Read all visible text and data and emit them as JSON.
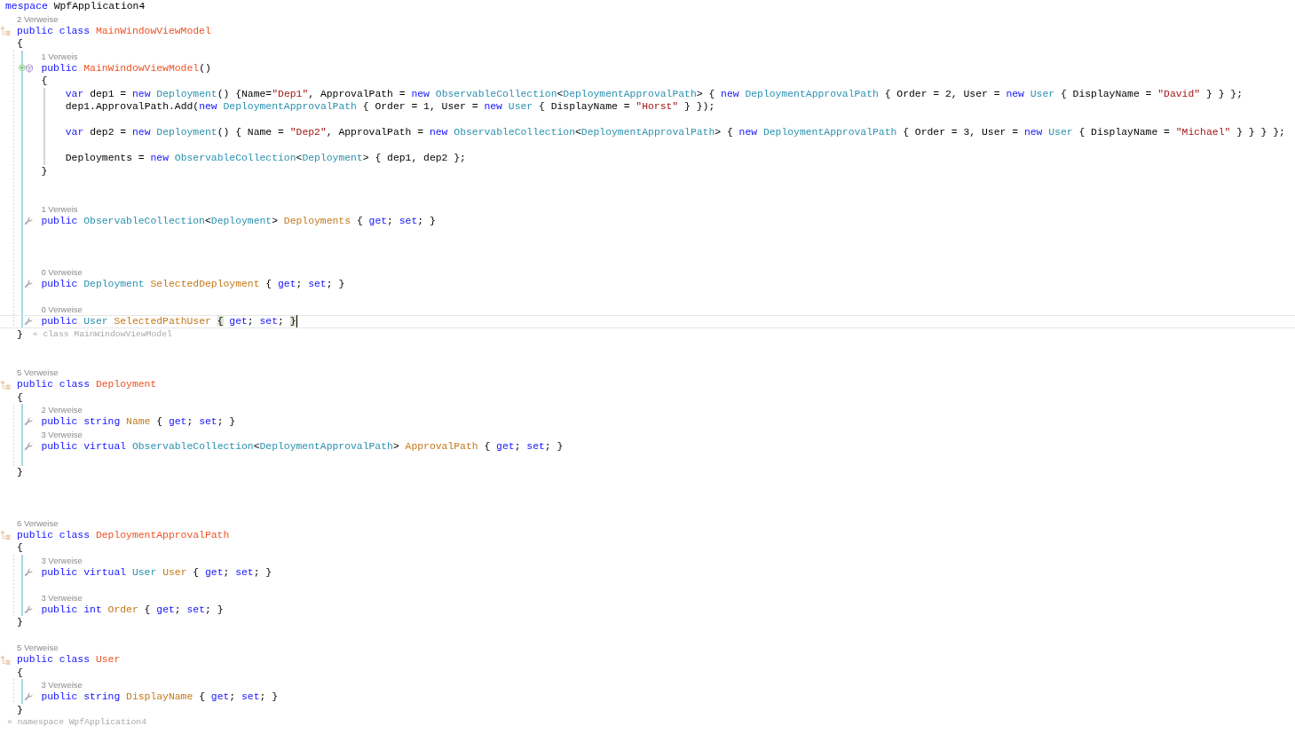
{
  "editor": {
    "lines": [
      {
        "kind": "code",
        "tokens": [
          {
            "text": "mespace",
            "kind": "keyword"
          },
          {
            "text": " WpfApplication4",
            "kind": "plain"
          }
        ]
      },
      {
        "kind": "block",
        "children": [
          {
            "kind": "lens",
            "text": "2 Verweise"
          },
          {
            "kind": "class",
            "tokens": [
              {
                "text": "public class ",
                "kind": "keyword"
              },
              {
                "text": "MainWindowViewModel",
                "kind": "declaration"
              }
            ]
          },
          {
            "kind": "code",
            "tokens": [
              {
                "text": "{",
                "kind": "plain"
              }
            ]
          },
          {
            "kind": "block",
            "children": [
              {
                "kind": "lens",
                "text": "1 Verweis"
              },
              {
                "kind": "method",
                "tokens": [
                  {
                    "text": "public ",
                    "kind": "keyword"
                  },
                  {
                    "text": "MainWindowViewModel",
                    "kind": "declaration"
                  },
                  {
                    "text": "()",
                    "kind": "plain"
                  }
                ]
              },
              {
                "kind": "code",
                "tokens": [
                  {
                    "text": "{",
                    "kind": "plain"
                  }
                ]
              },
              {
                "kind": "block",
                "children": [
                  {
                    "kind": "code",
                    "tokens": [
                      {
                        "text": "var",
                        "kind": "keyword"
                      },
                      {
                        "text": " dep1 = ",
                        "kind": "plain"
                      },
                      {
                        "text": "new ",
                        "kind": "keyword"
                      },
                      {
                        "text": "Deployment",
                        "kind": "type"
                      },
                      {
                        "text": "() {Name=",
                        "kind": "plain"
                      },
                      {
                        "text": "\"Dep1\"",
                        "kind": "string"
                      },
                      {
                        "text": ", ApprovalPath = ",
                        "kind": "plain"
                      },
                      {
                        "text": "new ",
                        "kind": "keyword"
                      },
                      {
                        "text": "ObservableCollection",
                        "kind": "type"
                      },
                      {
                        "text": "<",
                        "kind": "plain"
                      },
                      {
                        "text": "DeploymentApprovalPath",
                        "kind": "type"
                      },
                      {
                        "text": "> { ",
                        "kind": "plain"
                      },
                      {
                        "text": "new ",
                        "kind": "keyword"
                      },
                      {
                        "text": "DeploymentApprovalPath",
                        "kind": "type"
                      },
                      {
                        "text": " { Order = 2, User = ",
                        "kind": "plain"
                      },
                      {
                        "text": "new ",
                        "kind": "keyword"
                      },
                      {
                        "text": "User",
                        "kind": "type"
                      },
                      {
                        "text": " { DisplayName = ",
                        "kind": "plain"
                      },
                      {
                        "text": "\"David\"",
                        "kind": "string"
                      },
                      {
                        "text": " } } };",
                        "kind": "plain"
                      }
                    ]
                  },
                  {
                    "kind": "code",
                    "tokens": [
                      {
                        "text": "dep1.ApprovalPath.Add(",
                        "kind": "plain"
                      },
                      {
                        "text": "new ",
                        "kind": "keyword"
                      },
                      {
                        "text": "DeploymentApprovalPath",
                        "kind": "type"
                      },
                      {
                        "text": " { Order = 1, User = ",
                        "kind": "plain"
                      },
                      {
                        "text": "new ",
                        "kind": "keyword"
                      },
                      {
                        "text": "User",
                        "kind": "type"
                      },
                      {
                        "text": " { DisplayName = ",
                        "kind": "plain"
                      },
                      {
                        "text": "\"Horst\"",
                        "kind": "string"
                      },
                      {
                        "text": " } });",
                        "kind": "plain"
                      }
                    ]
                  },
                  {
                    "kind": "blank"
                  },
                  {
                    "kind": "code",
                    "tokens": [
                      {
                        "text": "var",
                        "kind": "keyword"
                      },
                      {
                        "text": " dep2 = ",
                        "kind": "plain"
                      },
                      {
                        "text": "new ",
                        "kind": "keyword"
                      },
                      {
                        "text": "Deployment",
                        "kind": "type"
                      },
                      {
                        "text": "() { Name = ",
                        "kind": "plain"
                      },
                      {
                        "text": "\"Dep2\"",
                        "kind": "string"
                      },
                      {
                        "text": ", ApprovalPath = ",
                        "kind": "plain"
                      },
                      {
                        "text": "new ",
                        "kind": "keyword"
                      },
                      {
                        "text": "ObservableCollection",
                        "kind": "type"
                      },
                      {
                        "text": "<",
                        "kind": "plain"
                      },
                      {
                        "text": "DeploymentApprovalPath",
                        "kind": "type"
                      },
                      {
                        "text": "> { ",
                        "kind": "plain"
                      },
                      {
                        "text": "new ",
                        "kind": "keyword"
                      },
                      {
                        "text": "DeploymentApprovalPath",
                        "kind": "type"
                      },
                      {
                        "text": " { Order = 3, User = ",
                        "kind": "plain"
                      },
                      {
                        "text": "new ",
                        "kind": "keyword"
                      },
                      {
                        "text": "User",
                        "kind": "type"
                      },
                      {
                        "text": " { DisplayName = ",
                        "kind": "plain"
                      },
                      {
                        "text": "\"Michael\"",
                        "kind": "string"
                      },
                      {
                        "text": " } } } };",
                        "kind": "plain"
                      }
                    ]
                  },
                  {
                    "kind": "blank"
                  },
                  {
                    "kind": "code",
                    "tokens": [
                      {
                        "text": "Deployments = ",
                        "kind": "plain"
                      },
                      {
                        "text": "new ",
                        "kind": "keyword"
                      },
                      {
                        "text": "ObservableCollection",
                        "kind": "type"
                      },
                      {
                        "text": "<",
                        "kind": "plain"
                      },
                      {
                        "text": "Deployment",
                        "kind": "type"
                      },
                      {
                        "text": "> { dep1, dep2 };",
                        "kind": "plain"
                      }
                    ]
                  }
                ]
              },
              {
                "kind": "code",
                "tokens": [
                  {
                    "text": "}",
                    "kind": "plain"
                  }
                ]
              },
              {
                "kind": "blank"
              },
              {
                "kind": "blank"
              },
              {
                "kind": "lens",
                "text": "1 Verweis"
              },
              {
                "kind": "property",
                "tokens": [
                  {
                    "text": "public ",
                    "kind": "keyword"
                  },
                  {
                    "text": "ObservableCollection",
                    "kind": "type"
                  },
                  {
                    "text": "<",
                    "kind": "plain"
                  },
                  {
                    "text": "Deployment",
                    "kind": "type"
                  },
                  {
                    "text": "> ",
                    "kind": "plain"
                  },
                  {
                    "text": "Deployments",
                    "kind": "property"
                  },
                  {
                    "text": " { ",
                    "kind": "plain"
                  },
                  {
                    "text": "get",
                    "kind": "keyword"
                  },
                  {
                    "text": "; ",
                    "kind": "plain"
                  },
                  {
                    "text": "set",
                    "kind": "keyword"
                  },
                  {
                    "text": "; }",
                    "kind": "plain"
                  }
                ]
              },
              {
                "kind": "blank"
              },
              {
                "kind": "blank"
              },
              {
                "kind": "blank"
              },
              {
                "kind": "lens",
                "text": "0 Verweise"
              },
              {
                "kind": "property",
                "tokens": [
                  {
                    "text": "public ",
                    "kind": "keyword"
                  },
                  {
                    "text": "Deployment ",
                    "kind": "type"
                  },
                  {
                    "text": "SelectedDeployment",
                    "kind": "property"
                  },
                  {
                    "text": " { ",
                    "kind": "plain"
                  },
                  {
                    "text": "get",
                    "kind": "keyword"
                  },
                  {
                    "text": "; ",
                    "kind": "plain"
                  },
                  {
                    "text": "set",
                    "kind": "keyword"
                  },
                  {
                    "text": "; }",
                    "kind": "plain"
                  }
                ]
              },
              {
                "kind": "blank"
              },
              {
                "kind": "lens",
                "text": "0 Verweise"
              },
              {
                "kind": "property",
                "current": true,
                "tokens": [
                  {
                    "text": "public ",
                    "kind": "keyword"
                  },
                  {
                    "text": "User ",
                    "kind": "type"
                  },
                  {
                    "text": "SelectedPathUser ",
                    "kind": "property"
                  },
                  {
                    "text": "{",
                    "kind": "plain",
                    "matched": true
                  },
                  {
                    "text": " get",
                    "kind": "keyword"
                  },
                  {
                    "text": "; ",
                    "kind": "plain"
                  },
                  {
                    "text": "set",
                    "kind": "keyword"
                  },
                  {
                    "text": "; ",
                    "kind": "plain"
                  },
                  {
                    "text": "}",
                    "kind": "plain",
                    "matched": true
                  }
                ]
              }
            ]
          },
          {
            "kind": "code",
            "tokens": [
              {
                "text": "}",
                "kind": "plain"
              }
            ],
            "hint": "« class MainWindowViewModel"
          },
          {
            "kind": "blank"
          },
          {
            "kind": "blank"
          },
          {
            "kind": "lens",
            "text": "5 Verweise"
          },
          {
            "kind": "class",
            "tokens": [
              {
                "text": "public class ",
                "kind": "keyword"
              },
              {
                "text": "Deployment",
                "kind": "declaration"
              }
            ]
          },
          {
            "kind": "code",
            "tokens": [
              {
                "text": "{",
                "kind": "plain"
              }
            ]
          },
          {
            "kind": "block",
            "children": [
              {
                "kind": "lens",
                "text": "2 Verweise"
              },
              {
                "kind": "property",
                "tokens": [
                  {
                    "text": "public string ",
                    "kind": "keyword"
                  },
                  {
                    "text": "Name",
                    "kind": "property"
                  },
                  {
                    "text": " { ",
                    "kind": "plain"
                  },
                  {
                    "text": "get",
                    "kind": "keyword"
                  },
                  {
                    "text": "; ",
                    "kind": "plain"
                  },
                  {
                    "text": "set",
                    "kind": "keyword"
                  },
                  {
                    "text": "; }",
                    "kind": "plain"
                  }
                ]
              },
              {
                "kind": "lens",
                "text": "3 Verweise"
              },
              {
                "kind": "property",
                "tokens": [
                  {
                    "text": "public virtual ",
                    "kind": "keyword"
                  },
                  {
                    "text": "ObservableCollection",
                    "kind": "type"
                  },
                  {
                    "text": "<",
                    "kind": "plain"
                  },
                  {
                    "text": "DeploymentApprovalPath",
                    "kind": "type"
                  },
                  {
                    "text": "> ",
                    "kind": "plain"
                  },
                  {
                    "text": "ApprovalPath",
                    "kind": "property"
                  },
                  {
                    "text": " { ",
                    "kind": "plain"
                  },
                  {
                    "text": "get",
                    "kind": "keyword"
                  },
                  {
                    "text": "; ",
                    "kind": "plain"
                  },
                  {
                    "text": "set",
                    "kind": "keyword"
                  },
                  {
                    "text": "; }",
                    "kind": "plain"
                  }
                ]
              },
              {
                "kind": "blank"
              }
            ]
          },
          {
            "kind": "code",
            "tokens": [
              {
                "text": "}",
                "kind": "plain"
              }
            ]
          },
          {
            "kind": "blank"
          },
          {
            "kind": "blank"
          },
          {
            "kind": "blank"
          },
          {
            "kind": "lens",
            "text": "6 Verweise"
          },
          {
            "kind": "class",
            "tokens": [
              {
                "text": "public class ",
                "kind": "keyword"
              },
              {
                "text": "DeploymentApprovalPath",
                "kind": "declaration"
              }
            ]
          },
          {
            "kind": "code",
            "tokens": [
              {
                "text": "{",
                "kind": "plain"
              }
            ]
          },
          {
            "kind": "block",
            "children": [
              {
                "kind": "lens",
                "text": "3 Verweise"
              },
              {
                "kind": "property",
                "tokens": [
                  {
                    "text": "public virtual ",
                    "kind": "keyword"
                  },
                  {
                    "text": "User ",
                    "kind": "type"
                  },
                  {
                    "text": "User",
                    "kind": "property"
                  },
                  {
                    "text": " { ",
                    "kind": "plain"
                  },
                  {
                    "text": "get",
                    "kind": "keyword"
                  },
                  {
                    "text": "; ",
                    "kind": "plain"
                  },
                  {
                    "text": "set",
                    "kind": "keyword"
                  },
                  {
                    "text": "; }",
                    "kind": "plain"
                  }
                ]
              },
              {
                "kind": "blank"
              },
              {
                "kind": "lens",
                "text": "3 Verweise"
              },
              {
                "kind": "property",
                "tokens": [
                  {
                    "text": "public int ",
                    "kind": "keyword"
                  },
                  {
                    "text": "Order",
                    "kind": "property"
                  },
                  {
                    "text": " { ",
                    "kind": "plain"
                  },
                  {
                    "text": "get",
                    "kind": "keyword"
                  },
                  {
                    "text": "; ",
                    "kind": "plain"
                  },
                  {
                    "text": "set",
                    "kind": "keyword"
                  },
                  {
                    "text": "; }",
                    "kind": "plain"
                  }
                ]
              }
            ]
          },
          {
            "kind": "code",
            "tokens": [
              {
                "text": "}",
                "kind": "plain"
              }
            ]
          },
          {
            "kind": "blank"
          },
          {
            "kind": "lens",
            "text": "5 Verweise"
          },
          {
            "kind": "class",
            "tokens": [
              {
                "text": "public class ",
                "kind": "keyword"
              },
              {
                "text": "User",
                "kind": "declaration"
              }
            ]
          },
          {
            "kind": "code",
            "tokens": [
              {
                "text": "{",
                "kind": "plain"
              }
            ]
          },
          {
            "kind": "block",
            "children": [
              {
                "kind": "lens",
                "text": "3 Verweise"
              },
              {
                "kind": "property",
                "tokens": [
                  {
                    "text": "public string ",
                    "kind": "keyword"
                  },
                  {
                    "text": "DisplayName",
                    "kind": "property"
                  },
                  {
                    "text": " { ",
                    "kind": "plain"
                  },
                  {
                    "text": "get",
                    "kind": "keyword"
                  },
                  {
                    "text": "; ",
                    "kind": "plain"
                  },
                  {
                    "text": "set",
                    "kind": "keyword"
                  },
                  {
                    "text": "; }",
                    "kind": "plain"
                  }
                ]
              }
            ]
          },
          {
            "kind": "code",
            "tokens": [
              {
                "text": "}",
                "kind": "plain"
              }
            ]
          }
        ]
      },
      {
        "kind": "hint",
        "text": "« namespace WpfApplication4"
      }
    ]
  }
}
